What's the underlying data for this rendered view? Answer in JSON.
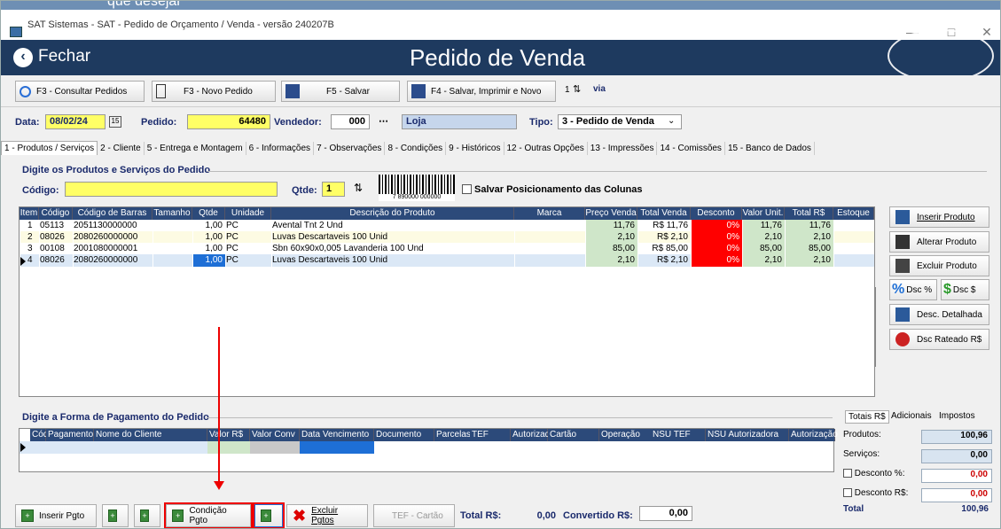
{
  "window": {
    "title": "SAT Sistemas - SAT - Pedido de Orçamento / Venda - versão 240207B"
  },
  "header": {
    "close_label": "Fechar",
    "title": "Pedido de Venda"
  },
  "toolbar": {
    "consult": "F3 - Consultar Pedidos",
    "new": "F3 - Novo Pedido",
    "save": "F5 - Salvar",
    "save_print": "F4 - Salvar, Imprimir e Novo",
    "copies": "1",
    "via": "via"
  },
  "order": {
    "data_label": "Data:",
    "data": "08/02/24",
    "pedido_label": "Pedido:",
    "pedido": "64480",
    "vendedor_label": "Vendedor:",
    "vendedor": "000",
    "loja": "Loja",
    "tipo_label": "Tipo:",
    "tipo": "3 - Pedido de Venda"
  },
  "tabs": [
    "1 - Produtos / Serviços",
    "2 - Cliente",
    "5 - Entrega e Montagem",
    "6 - Informações",
    "7 - Observações",
    "8 - Condições",
    "9 - Históricos",
    "12 - Outras Opções",
    "13 - Impressões",
    "14 - Comissões",
    "15 - Banco de Dados"
  ],
  "products": {
    "section": "Digite os Produtos e Serviços do Pedido",
    "codigo_label": "Código:",
    "qtde_label": "Qtde:",
    "qtde": "1",
    "save_cols": "Salvar Posicionamento das Colunas",
    "barcode_digits": "7 890000 000000",
    "columns": [
      "Item",
      "Código",
      "Código de Barras",
      "Tamanho",
      "Qtde",
      "Unidade",
      "Descrição do Produto",
      "Marca",
      "Preço Venda",
      "Total Venda",
      "Desconto",
      "Valor Unit.",
      "Total R$",
      "Estoque"
    ],
    "rows": [
      [
        "1",
        "05113",
        "2051130000000",
        "",
        "1,00",
        "PC",
        "Avental Tnt 2 Und",
        "",
        "11,76",
        "R$ 11,76",
        "0%",
        "11,76",
        "11,76",
        ""
      ],
      [
        "2",
        "08026",
        "2080260000000",
        "",
        "1,00",
        "PC",
        "Luvas Descartaveis 100 Unid",
        "",
        "2,10",
        "R$ 2,10",
        "0%",
        "2,10",
        "2,10",
        ""
      ],
      [
        "3",
        "00108",
        "2001080000001",
        "",
        "1,00",
        "PC",
        "Sbn 60x90x0,005 Lavanderia 100 Und",
        "",
        "85,00",
        "R$ 85,00",
        "0%",
        "85,00",
        "85,00",
        ""
      ],
      [
        "4",
        "08026",
        "2080260000000",
        "",
        "1,00",
        "PC",
        "Luvas Descartaveis 100 Unid",
        "",
        "2,10",
        "R$ 2,10",
        "0%",
        "2,10",
        "2,10",
        ""
      ]
    ]
  },
  "side": {
    "insert": "Inserir Produto",
    "alter": "Alterar Produto",
    "delete": "Excluir Produto",
    "dsc_pct": "Dsc %",
    "dsc_val": "Dsc $",
    "detail": "Desc. Detalhada",
    "rateado": "Dsc Rateado R$"
  },
  "payment": {
    "section": "Digite a Forma de Pagamento do Pedido",
    "columns": [
      "Cód",
      "Pagamento",
      "Nome do Cliente",
      "Valor R$",
      "Valor Conv",
      "Data Vencimento",
      "Documento",
      "Parcelas",
      "TEF",
      "Autorizador",
      "Cartão",
      "Operação",
      "NSU TEF",
      "NSU Autorizadora",
      "Autorização"
    ]
  },
  "totals": {
    "tabs": [
      "Totais R$",
      "Adicionais",
      "Impostos"
    ],
    "produtos_label": "Produtos:",
    "produtos": "100,96",
    "servicos_label": "Serviços:",
    "servicos": "0,00",
    "desc_pct_label": "Desconto   %:",
    "desc_pct": "0,00",
    "desc_val_label": "Desconto  R$:",
    "desc_val": "0,00",
    "total_label": "Total",
    "total": "100,96"
  },
  "bottom": {
    "insert_pgto": "Inserir Pgto",
    "cond_pgto": "Condição Pgto",
    "excluir": "Excluir Pgtos",
    "tef": "TEF - Cartão",
    "total_label": "Total R$:",
    "total": "0,00",
    "conv_label": "Convertido R$:",
    "conv": "0,00"
  },
  "annotation": {
    "overlay_text": "que desejar"
  }
}
